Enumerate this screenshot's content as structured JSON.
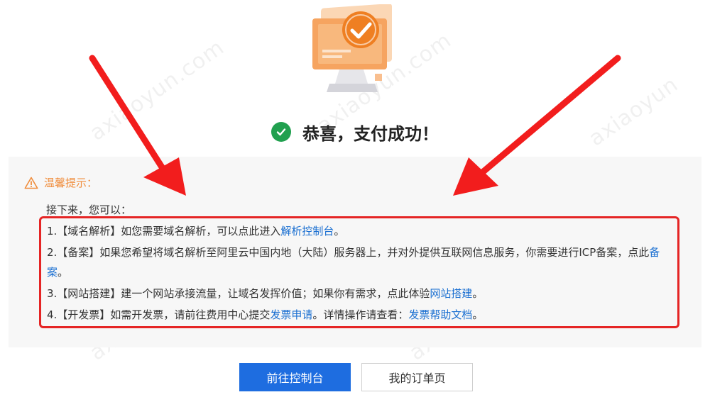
{
  "success": {
    "title": "恭喜，支付成功！",
    "icon": "check-circle-icon"
  },
  "tips": {
    "title": "温馨提示：",
    "icon": "warning-triangle-icon",
    "intro": "接下来，您可以：",
    "items": [
      {
        "prefix": "1.【域名解析】如您需要域名解析，可以点此进入",
        "link1": "解析控制台",
        "mid": "。",
        "link2": "",
        "suffix": ""
      },
      {
        "prefix": "2.【备案】如果您希望将域名解析至阿里云中国内地（大陆）服务器上，并对外提供互联网信息服务，你需要进行ICP备案，点此",
        "link1": "备案",
        "mid": "。",
        "link2": "",
        "suffix": ""
      },
      {
        "prefix": "3.【网站搭建】建一个网站承接流量，让域名发挥价值；如果你有需求，点此体验",
        "link1": "网站搭建",
        "mid": "。",
        "link2": "",
        "suffix": ""
      },
      {
        "prefix": "4.【开发票】如需开发票，请前往费用中心提交",
        "link1": "发票申请",
        "mid": "。详情操作请查看：",
        "link2": "发票帮助文档",
        "suffix": "。"
      }
    ]
  },
  "buttons": {
    "primary": "前往控制台",
    "secondary": "我的订单页"
  },
  "colors": {
    "accent": "#1e6de0",
    "success": "#21a04f",
    "warning": "#f08d3c",
    "highlight": "#e52525",
    "link": "#1a6fd1"
  }
}
